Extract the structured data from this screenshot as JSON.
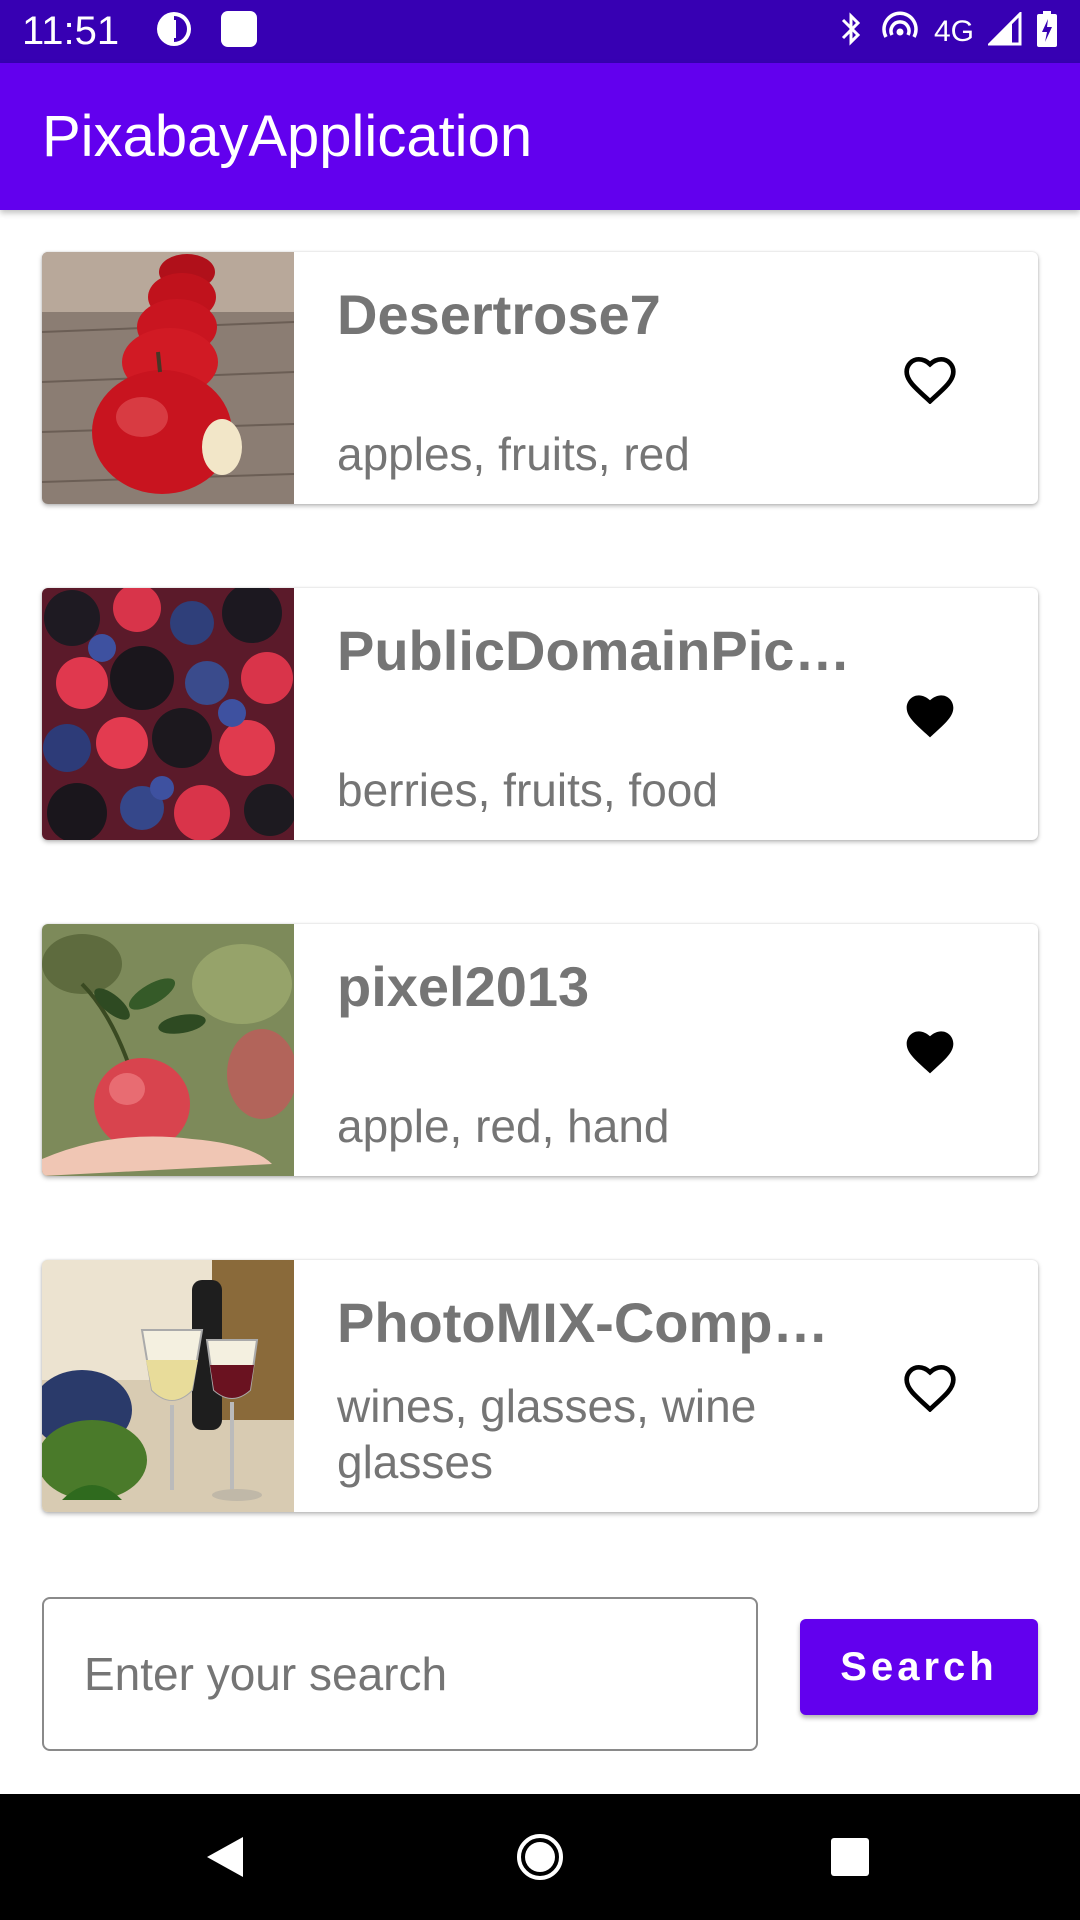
{
  "status_bar": {
    "time": "11:51",
    "network": "4G"
  },
  "app_bar": {
    "title": "PixabayApplication"
  },
  "items": [
    {
      "user": "Desertrose7",
      "tags": "apples, fruits, red",
      "favorite": false
    },
    {
      "user": "PublicDomainPic…",
      "tags": "berries, fruits, food",
      "favorite": true
    },
    {
      "user": "pixel2013",
      "tags": "apple, red, hand",
      "favorite": true
    },
    {
      "user": "PhotoMIX-Comp…",
      "tags": "wines, glasses, wine glasses",
      "favorite": false
    }
  ],
  "search": {
    "placeholder": "Enter your search",
    "value": "",
    "button_label": "Search"
  },
  "colors": {
    "status_bar": "#3700b3",
    "primary": "#6200ee",
    "text_secondary": "#757575"
  },
  "icons": {
    "favorite_on": "heart-filled-icon",
    "favorite_off": "heart-outline-icon",
    "nav": [
      "back-icon",
      "home-icon",
      "recents-icon"
    ]
  }
}
